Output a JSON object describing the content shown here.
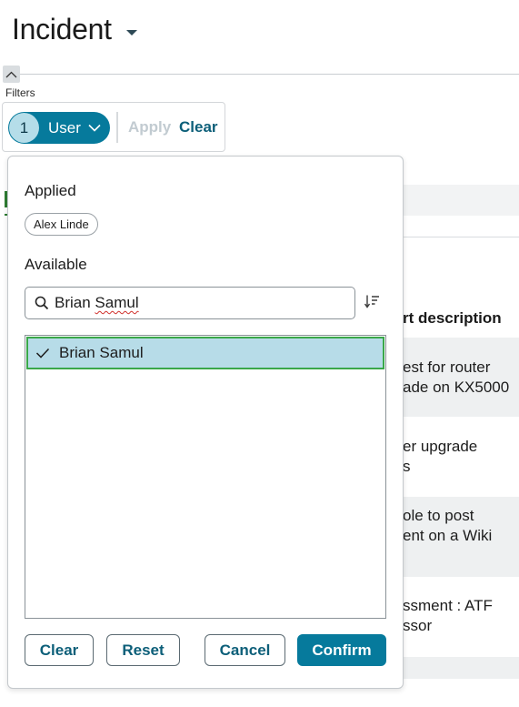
{
  "page": {
    "title": "Incident"
  },
  "filters": {
    "label": "Filters",
    "user_pill": {
      "count": "1",
      "label": "User"
    },
    "apply_label": "Apply",
    "clear_label": "Clear"
  },
  "background_table": {
    "column_header": "rt description",
    "rows": [
      {
        "line1": "est for router",
        "line2": "ade on KX5000"
      },
      {
        "line1": "er upgrade",
        "line2": "s"
      },
      {
        "line1": "ole to post",
        "line2": "ent on a Wiki"
      },
      {
        "line1": "ssment : ATF",
        "line2": "ssor"
      }
    ]
  },
  "popover": {
    "applied_heading": "Applied",
    "applied_chip": "Alex Linde",
    "available_heading": "Available",
    "search": {
      "value_first": "Brian",
      "value_second": "Samul"
    },
    "list_items": [
      {
        "label": "Brian Samul",
        "selected": true
      }
    ],
    "buttons": {
      "clear": "Clear",
      "reset": "Reset",
      "cancel": "Cancel",
      "confirm": "Confirm"
    }
  },
  "colors": {
    "primary": "#067a9c",
    "link": "#0d5f79",
    "selected_bg": "#b7dce8",
    "selected_border": "#3aa84a"
  },
  "icons": [
    "collapse-chevron-up-icon",
    "caret-down-icon",
    "chevron-down-icon",
    "search-icon",
    "sort-icon",
    "checkmark-icon"
  ]
}
